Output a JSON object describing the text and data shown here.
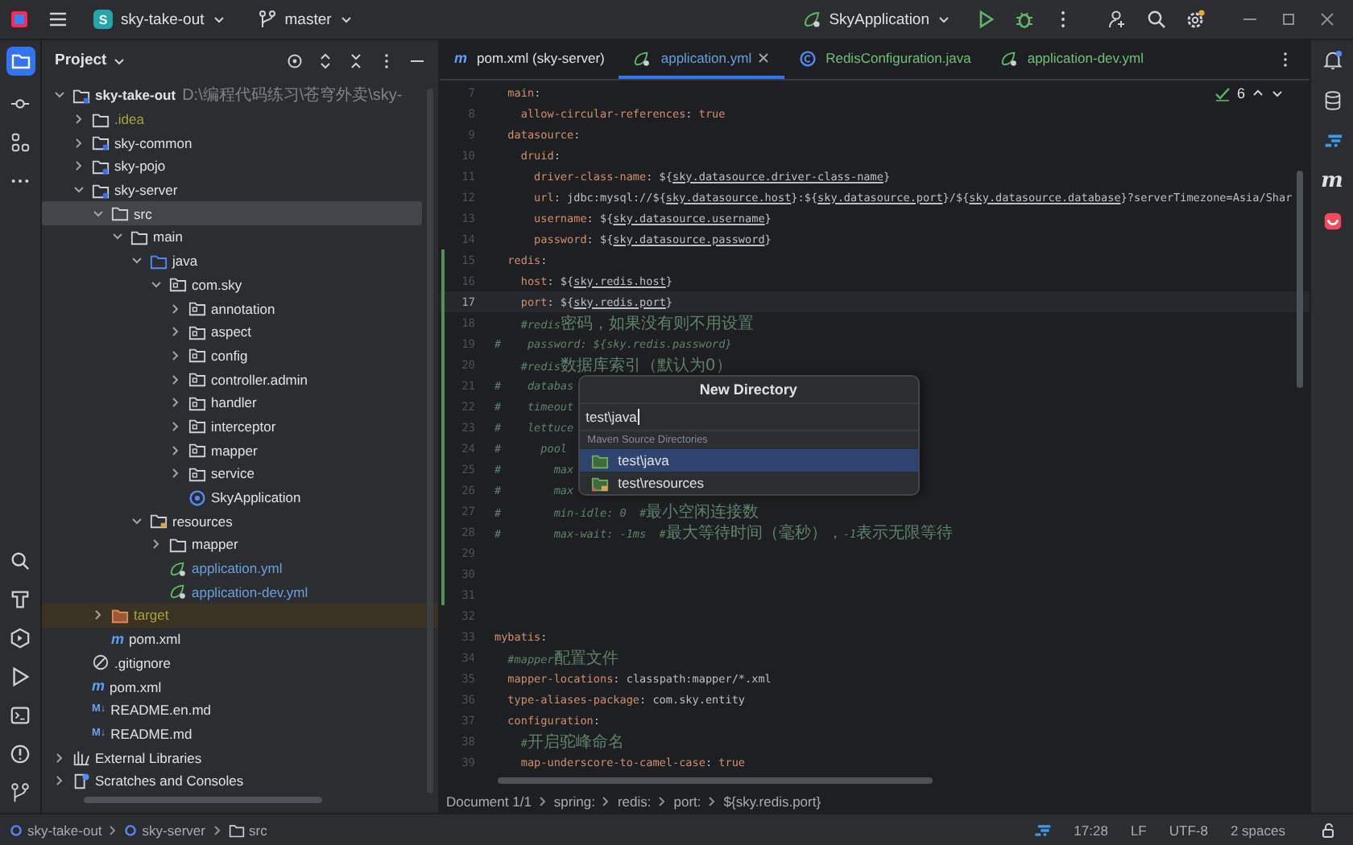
{
  "title_bar": {
    "project_badge": "S",
    "project": "sky-take-out",
    "branch": "master",
    "run_config": "SkyApplication"
  },
  "right_strip": {
    "maven_badge": "m"
  },
  "project_panel": {
    "title": "Project",
    "tree": [
      {
        "label": "sky-take-out",
        "kind": "module",
        "hint": "D:\\编程代码练习\\苍穹外卖\\sky-",
        "expanded": true,
        "selected": false,
        "children": [
          {
            "label": ".idea",
            "kind": "folder",
            "ignored": true,
            "expanded": false,
            "selected": false
          },
          {
            "label": "sky-common",
            "kind": "module",
            "expanded": false,
            "selected": false
          },
          {
            "label": "sky-pojo",
            "kind": "module",
            "expanded": false,
            "selected": false
          },
          {
            "label": "sky-server",
            "kind": "module",
            "expanded": true,
            "selected": false,
            "children": [
              {
                "label": "src",
                "kind": "folder",
                "expanded": true,
                "selected": true,
                "children": [
                  {
                    "label": "main",
                    "kind": "folder",
                    "expanded": true,
                    "selected": false,
                    "children": [
                      {
                        "label": "java",
                        "kind": "source",
                        "expanded": true,
                        "selected": false,
                        "children": [
                          {
                            "label": "com.sky",
                            "kind": "package",
                            "expanded": true,
                            "selected": false,
                            "children": [
                              {
                                "label": "annotation",
                                "kind": "package",
                                "expanded": false,
                                "selected": false
                              },
                              {
                                "label": "aspect",
                                "kind": "package",
                                "expanded": false,
                                "selected": false
                              },
                              {
                                "label": "config",
                                "kind": "package",
                                "expanded": false,
                                "selected": false
                              },
                              {
                                "label": "controller.admin",
                                "kind": "package",
                                "expanded": false,
                                "selected": false
                              },
                              {
                                "label": "handler",
                                "kind": "package",
                                "expanded": false,
                                "selected": false
                              },
                              {
                                "label": "interceptor",
                                "kind": "package",
                                "expanded": false,
                                "selected": false
                              },
                              {
                                "label": "mapper",
                                "kind": "package",
                                "expanded": false,
                                "selected": false
                              },
                              {
                                "label": "service",
                                "kind": "package",
                                "expanded": false,
                                "selected": false
                              },
                              {
                                "label": "SkyApplication",
                                "kind": "class",
                                "selected": false
                              }
                            ]
                          }
                        ]
                      },
                      {
                        "label": "resources",
                        "kind": "resources",
                        "expanded": true,
                        "selected": false,
                        "children": [
                          {
                            "label": "mapper",
                            "kind": "folder",
                            "expanded": false,
                            "selected": false
                          },
                          {
                            "label": "application.yml",
                            "kind": "yml",
                            "modified": true,
                            "selected": false
                          },
                          {
                            "label": "application-dev.yml",
                            "kind": "yml",
                            "modified": true,
                            "selected": false
                          }
                        ]
                      }
                    ]
                  }
                ]
              },
              {
                "label": "target",
                "kind": "folder",
                "excluded": true,
                "expanded": false,
                "selected": false
              },
              {
                "label": "pom.xml",
                "kind": "maven",
                "badge": "m",
                "selected": false
              }
            ]
          },
          {
            "label": ".gitignore",
            "kind": "gitignore",
            "selected": false
          },
          {
            "label": "pom.xml",
            "kind": "maven",
            "badge": "m",
            "selected": false
          },
          {
            "label": "README.en.md",
            "kind": "markdown",
            "badge": "M↓",
            "selected": false
          },
          {
            "label": "README.md",
            "kind": "markdown",
            "badge": "M↓",
            "selected": false
          }
        ]
      },
      {
        "label": "External Libraries",
        "kind": "libraries",
        "expanded": false,
        "selected": false
      },
      {
        "label": "Scratches and Consoles",
        "kind": "scratches",
        "expanded": false,
        "selected": false
      }
    ]
  },
  "editor": {
    "tabs": [
      {
        "label": "pom.xml (sky-server)",
        "kind": "maven",
        "badge": "m",
        "modified": false,
        "added": false,
        "selected": false
      },
      {
        "label": "application.yml",
        "kind": "yml",
        "modified": true,
        "added": false,
        "selected": true
      },
      {
        "label": "RedisConfiguration.java",
        "kind": "class",
        "modified": false,
        "added": true,
        "selected": false
      },
      {
        "label": "application-dev.yml",
        "kind": "yml",
        "modified": false,
        "added": true,
        "selected": false
      }
    ],
    "inspection_count": "6",
    "lines": [
      {
        "no": "7",
        "current": false,
        "changed": false,
        "parts": [
          {
            "kind": "key",
            "text": "  main"
          },
          {
            "kind": "plain",
            "text": ":"
          }
        ]
      },
      {
        "no": "8",
        "current": false,
        "changed": false,
        "parts": [
          {
            "kind": "key",
            "text": "    allow-circular-references"
          },
          {
            "kind": "plain",
            "text": ": "
          },
          {
            "kind": "key",
            "text": "true"
          }
        ]
      },
      {
        "no": "9",
        "current": false,
        "changed": false,
        "parts": [
          {
            "kind": "key",
            "text": "  datasource"
          },
          {
            "kind": "plain",
            "text": ":"
          }
        ]
      },
      {
        "no": "10",
        "current": false,
        "changed": false,
        "parts": [
          {
            "kind": "key",
            "text": "    druid"
          },
          {
            "kind": "plain",
            "text": ":"
          }
        ]
      },
      {
        "no": "11",
        "current": false,
        "changed": false,
        "parts": [
          {
            "kind": "key",
            "text": "      driver-class-name"
          },
          {
            "kind": "plain",
            "text": ": ${"
          },
          {
            "kind": "ref",
            "text": "sky.datasource.driver-class-name"
          },
          {
            "kind": "plain",
            "text": "}"
          }
        ]
      },
      {
        "no": "12",
        "current": false,
        "changed": false,
        "parts": [
          {
            "kind": "key",
            "text": "      url"
          },
          {
            "kind": "plain",
            "text": ": jdbc:mysql://${"
          },
          {
            "kind": "ref",
            "text": "sky.datasource.host"
          },
          {
            "kind": "plain",
            "text": "}:${"
          },
          {
            "kind": "ref",
            "text": "sky.datasource.port"
          },
          {
            "kind": "plain",
            "text": "}/${"
          },
          {
            "kind": "ref",
            "text": "sky.datasource.database"
          },
          {
            "kind": "plain",
            "text": "}?serverTimezone=Asia/Shar"
          }
        ]
      },
      {
        "no": "13",
        "current": false,
        "changed": false,
        "parts": [
          {
            "kind": "key",
            "text": "      username"
          },
          {
            "kind": "plain",
            "text": ": ${"
          },
          {
            "kind": "ref",
            "text": "sky.datasource.username"
          },
          {
            "kind": "plain",
            "text": "}"
          }
        ]
      },
      {
        "no": "14",
        "current": false,
        "changed": false,
        "parts": [
          {
            "kind": "key",
            "text": "      password"
          },
          {
            "kind": "plain",
            "text": ": ${"
          },
          {
            "kind": "ref",
            "text": "sky.datasource.password"
          },
          {
            "kind": "plain",
            "text": "}"
          }
        ]
      },
      {
        "no": "15",
        "current": false,
        "changed": true,
        "parts": [
          {
            "kind": "key",
            "text": "  redis"
          },
          {
            "kind": "plain",
            "text": ":"
          }
        ]
      },
      {
        "no": "16",
        "current": false,
        "changed": true,
        "parts": [
          {
            "kind": "key",
            "text": "    host"
          },
          {
            "kind": "plain",
            "text": ": ${"
          },
          {
            "kind": "ref",
            "text": "sky.redis.host"
          },
          {
            "kind": "plain",
            "text": "}"
          }
        ]
      },
      {
        "no": "17",
        "current": true,
        "changed": true,
        "parts": [
          {
            "kind": "key",
            "text": "    port"
          },
          {
            "kind": "plain",
            "text": ": ${"
          },
          {
            "kind": "ref",
            "text": "sky.redis.port"
          },
          {
            "kind": "plain",
            "text": "}"
          }
        ]
      },
      {
        "no": "18",
        "current": false,
        "changed": true,
        "parts": [
          {
            "kind": "comment",
            "text": "    #redis"
          },
          {
            "kind": "note",
            "text": "密码，如果没有则不用设置"
          }
        ]
      },
      {
        "no": "19",
        "current": false,
        "changed": true,
        "parts": [
          {
            "kind": "comment",
            "text": "#    password: ${sky.redis.password}"
          }
        ]
      },
      {
        "no": "20",
        "current": false,
        "changed": true,
        "parts": [
          {
            "kind": "comment",
            "text": "    #redis"
          },
          {
            "kind": "note",
            "text": "数据库索引（默认为0）"
          }
        ]
      },
      {
        "no": "21",
        "current": false,
        "changed": true,
        "parts": [
          {
            "kind": "comment",
            "text": "#    databas"
          }
        ]
      },
      {
        "no": "22",
        "current": false,
        "changed": true,
        "parts": [
          {
            "kind": "comment",
            "text": "#    timeout"
          }
        ]
      },
      {
        "no": "23",
        "current": false,
        "changed": true,
        "parts": [
          {
            "kind": "comment",
            "text": "#    lettuce"
          }
        ]
      },
      {
        "no": "24",
        "current": false,
        "changed": true,
        "parts": [
          {
            "kind": "comment",
            "text": "#      pool"
          }
        ]
      },
      {
        "no": "25",
        "current": false,
        "changed": true,
        "parts": [
          {
            "kind": "comment",
            "text": "#        max"
          }
        ]
      },
      {
        "no": "26",
        "current": false,
        "changed": true,
        "parts": [
          {
            "kind": "comment",
            "text": "#        max"
          }
        ]
      },
      {
        "no": "27",
        "current": false,
        "changed": true,
        "parts": [
          {
            "kind": "comment",
            "text": "#        min-idle: 0  #"
          },
          {
            "kind": "note",
            "text": "最小空闲连接数"
          }
        ]
      },
      {
        "no": "28",
        "current": false,
        "changed": true,
        "parts": [
          {
            "kind": "comment",
            "text": "#        max-wait: -1ms  #"
          },
          {
            "kind": "note",
            "text": "最大等待时间（毫秒），"
          },
          {
            "kind": "comment",
            "text": "-1"
          },
          {
            "kind": "note",
            "text": "表示无限等待"
          }
        ]
      },
      {
        "no": "29",
        "current": false,
        "changed": true
      },
      {
        "no": "30",
        "current": false,
        "changed": true
      },
      {
        "no": "31",
        "current": false,
        "changed": true
      },
      {
        "no": "32",
        "current": false,
        "changed": false
      },
      {
        "no": "33",
        "current": false,
        "changed": false,
        "parts": [
          {
            "kind": "key",
            "text": "mybatis"
          },
          {
            "kind": "plain",
            "text": ":"
          }
        ]
      },
      {
        "no": "34",
        "current": false,
        "changed": false,
        "parts": [
          {
            "kind": "comment",
            "text": "  #mapper"
          },
          {
            "kind": "note",
            "text": "配置文件"
          }
        ]
      },
      {
        "no": "35",
        "current": false,
        "changed": false,
        "parts": [
          {
            "kind": "key",
            "text": "  mapper-locations"
          },
          {
            "kind": "plain",
            "text": ": classpath:mapper/*.xml"
          }
        ]
      },
      {
        "no": "36",
        "current": false,
        "changed": false,
        "parts": [
          {
            "kind": "key",
            "text": "  type-aliases-package"
          },
          {
            "kind": "plain",
            "text": ": com.sky.entity"
          }
        ]
      },
      {
        "no": "37",
        "current": false,
        "changed": false,
        "parts": [
          {
            "kind": "key",
            "text": "  configuration"
          },
          {
            "kind": "plain",
            "text": ":"
          }
        ]
      },
      {
        "no": "38",
        "current": false,
        "changed": false,
        "parts": [
          {
            "kind": "comment",
            "text": "    #"
          },
          {
            "kind": "note",
            "text": "开启驼峰命名"
          }
        ]
      },
      {
        "no": "39",
        "current": false,
        "changed": false,
        "parts": [
          {
            "kind": "key",
            "text": "    map-underscore-to-camel-case"
          },
          {
            "kind": "plain",
            "text": ": "
          },
          {
            "kind": "key",
            "text": "true"
          }
        ]
      }
    ],
    "breadcrumbs": [
      "Document 1/1",
      "spring:",
      "redis:",
      "port:",
      "${sky.redis.port}"
    ]
  },
  "dialog": {
    "title": "New Directory",
    "value": "test\\java",
    "section": "Maven Source Directories",
    "items": [
      {
        "label": "test\\java",
        "kind": "source",
        "selected": true
      },
      {
        "label": "test\\resources",
        "kind": "resources",
        "selected": false
      }
    ]
  },
  "status_bar": {
    "path": [
      {
        "label": "sky-take-out",
        "kind": "module"
      },
      {
        "label": "sky-server",
        "kind": "module"
      },
      {
        "label": "src",
        "kind": "folder"
      }
    ],
    "position": "17:28",
    "line_ending": "LF",
    "encoding": "UTF-8",
    "indent": "2 spaces"
  }
}
